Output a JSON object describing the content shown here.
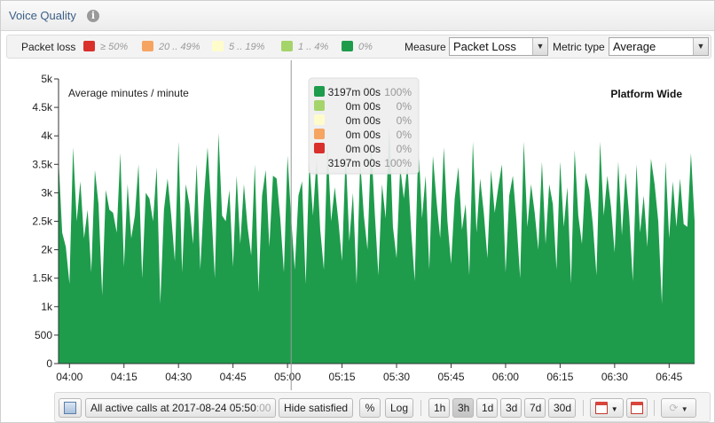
{
  "panel": {
    "title": "Voice Quality",
    "info_icon": "info-icon"
  },
  "legend": {
    "title": "Packet loss",
    "items": [
      {
        "label": "≥ 50%",
        "color": "#d9302c"
      },
      {
        "label": "20 .. 49%",
        "color": "#f5a462"
      },
      {
        "label": "5 .. 19%",
        "color": "#fffccc"
      },
      {
        "label": "1 .. 4%",
        "color": "#a5d46a"
      },
      {
        "label": "0%",
        "color": "#1e9c4c"
      }
    ]
  },
  "controls": {
    "measure_label": "Measure",
    "measure_value": "Packet Loss",
    "metric_label": "Metric type",
    "metric_value": "Average"
  },
  "chart_data": {
    "type": "area",
    "subtitle": "Average minutes / minute",
    "scope_label": "Platform Wide",
    "color": "#1e9c4c",
    "ylim": [
      0,
      5000
    ],
    "y_ticks": [
      "0",
      "500",
      "1k",
      "1.5k",
      "2k",
      "2.5k",
      "3k",
      "3.5k",
      "4k",
      "4.5k",
      "5k"
    ],
    "x_ticks": [
      "04:00",
      "04:15",
      "04:30",
      "04:45",
      "05:00",
      "05:15",
      "05:30",
      "05:45",
      "06:00",
      "06:15",
      "06:30",
      "06:45"
    ],
    "x_range": [
      "03:57",
      "06:52"
    ],
    "cursor_time": "05:01",
    "series": [
      {
        "name": "0%",
        "values": [
          3600,
          2300,
          2050,
          1400,
          3800,
          2500,
          3200,
          2200,
          2700,
          1600,
          3400,
          2800,
          1200,
          3050,
          2700,
          2650,
          2300,
          3700,
          1700,
          3150,
          2200,
          2600,
          3500,
          1500,
          3000,
          2900,
          2500,
          3450,
          1050,
          2700,
          3250,
          2600,
          1800,
          3900,
          1600,
          3150,
          2800,
          2100,
          3500,
          1650,
          2900,
          3800,
          2750,
          1500,
          4050,
          2600,
          2500,
          3050,
          1700,
          3300,
          2100,
          3150,
          2400,
          1900,
          3500,
          1250,
          2950,
          3400,
          2050,
          3300,
          3250,
          2550,
          1600,
          3650,
          2550,
          1650,
          2950,
          3200,
          1400,
          3550,
          2600,
          3600,
          2350,
          1650,
          3850,
          2500,
          3100,
          2500,
          1800,
          3700,
          2150,
          3000,
          1400,
          3550,
          2600,
          2000,
          3900,
          2650,
          1550,
          3150,
          2550,
          4200,
          2400,
          1850,
          3450,
          2900,
          3500,
          2350,
          1450,
          3900,
          2550,
          3300,
          1650,
          3650,
          2850,
          2200,
          3800,
          2500,
          1750,
          2900,
          3450,
          2350,
          2800,
          1550,
          3900,
          2300,
          3250,
          2650,
          1850,
          3400,
          2650,
          3100,
          3500,
          1600,
          2950,
          3300,
          2500,
          1500,
          3900,
          2400,
          3150,
          2650,
          2000,
          3550,
          2100,
          3150,
          2800,
          1650,
          3550,
          2400,
          3100,
          1400,
          3750,
          2600,
          2100,
          3350,
          3050,
          2450,
          1550,
          3900,
          2600,
          3300,
          2750,
          1950,
          3550,
          2250,
          3350,
          2600,
          1450,
          3500,
          2300,
          2950,
          2050,
          3600,
          3150,
          2500,
          1050,
          3550,
          2200,
          3200,
          2400,
          3250,
          2450,
          2400,
          3700,
          2500
        ]
      }
    ],
    "tooltip": {
      "rows": [
        {
          "color": "#1e9c4c",
          "value": "3197m 00s",
          "pct": "100%"
        },
        {
          "color": "#a5d46a",
          "value": "0m 00s",
          "pct": "0%"
        },
        {
          "color": "#fffccc",
          "value": "0m 00s",
          "pct": "0%"
        },
        {
          "color": "#f5a462",
          "value": "0m 00s",
          "pct": "0%"
        },
        {
          "color": "#d9302c",
          "value": "0m 00s",
          "pct": "0%"
        }
      ],
      "total_value": "3197m 00s",
      "total_pct": "100%"
    }
  },
  "toolbar": {
    "grid_icon": "table-icon",
    "active_calls_prefix": "All active calls at 2017-08-24 05:50",
    "active_calls_seconds": ":00",
    "hide_satisfied": "Hide satisfied",
    "percent": "%",
    "log": "Log",
    "ranges": [
      "1h",
      "3h",
      "1d",
      "3d",
      "7d",
      "30d"
    ],
    "active_range": "3h",
    "calendar_icon": "calendar-icon",
    "calendar_today_icon": "calendar-today-icon",
    "refresh_icon": "refresh-icon",
    "dropdown_icon": "chevron-down-icon"
  }
}
